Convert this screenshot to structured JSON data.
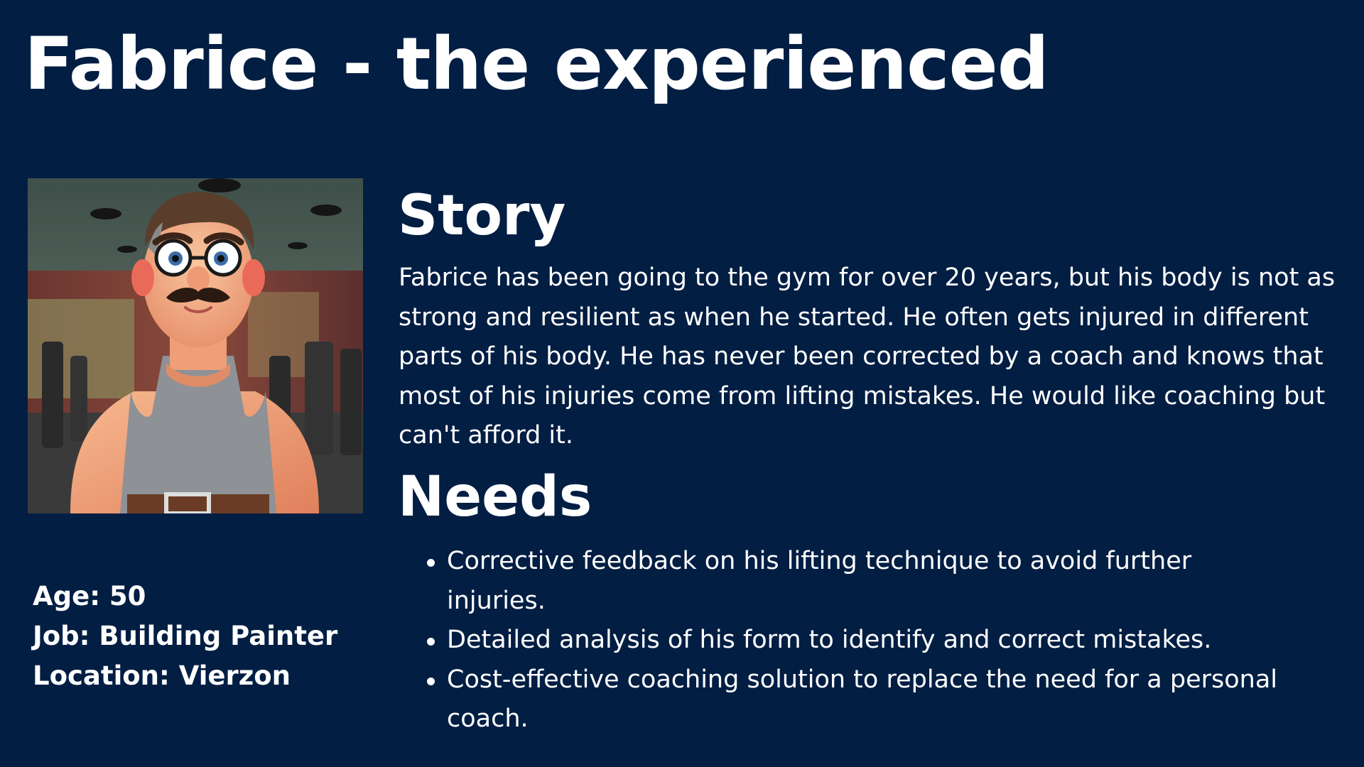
{
  "title": "Fabrice - the experienced",
  "portrait": {
    "alt": "Cartoon man with mustache and glasses in a gray tank top at a gym",
    "colors": {
      "ceiling": "#53645b",
      "wall": "#7a3f3a",
      "skin": "#f0a07c",
      "tank_top": "#8e9196",
      "hair": "#5a3d2b"
    }
  },
  "info": {
    "age": "Age: 50",
    "job": "Job: Building Painter",
    "location": "Location: Vierzon"
  },
  "story": {
    "heading": "Story",
    "text": "Fabrice has been going to the gym for over 20 years, but his body is not as strong and resilient as when he started. He often gets injured in different parts of his body. He has never been corrected by a coach and knows that most of his injuries come from lifting mistakes. He would like coaching but can't afford it."
  },
  "needs": {
    "heading": "Needs",
    "items": [
      "Corrective feedback on his lifting technique to avoid further injuries.",
      "Detailed analysis of his form to identify and correct mistakes.",
      "Cost-effective coaching solution to replace the need for a personal coach."
    ]
  },
  "colors": {
    "background": "#021e43",
    "text": "#ffffff"
  }
}
